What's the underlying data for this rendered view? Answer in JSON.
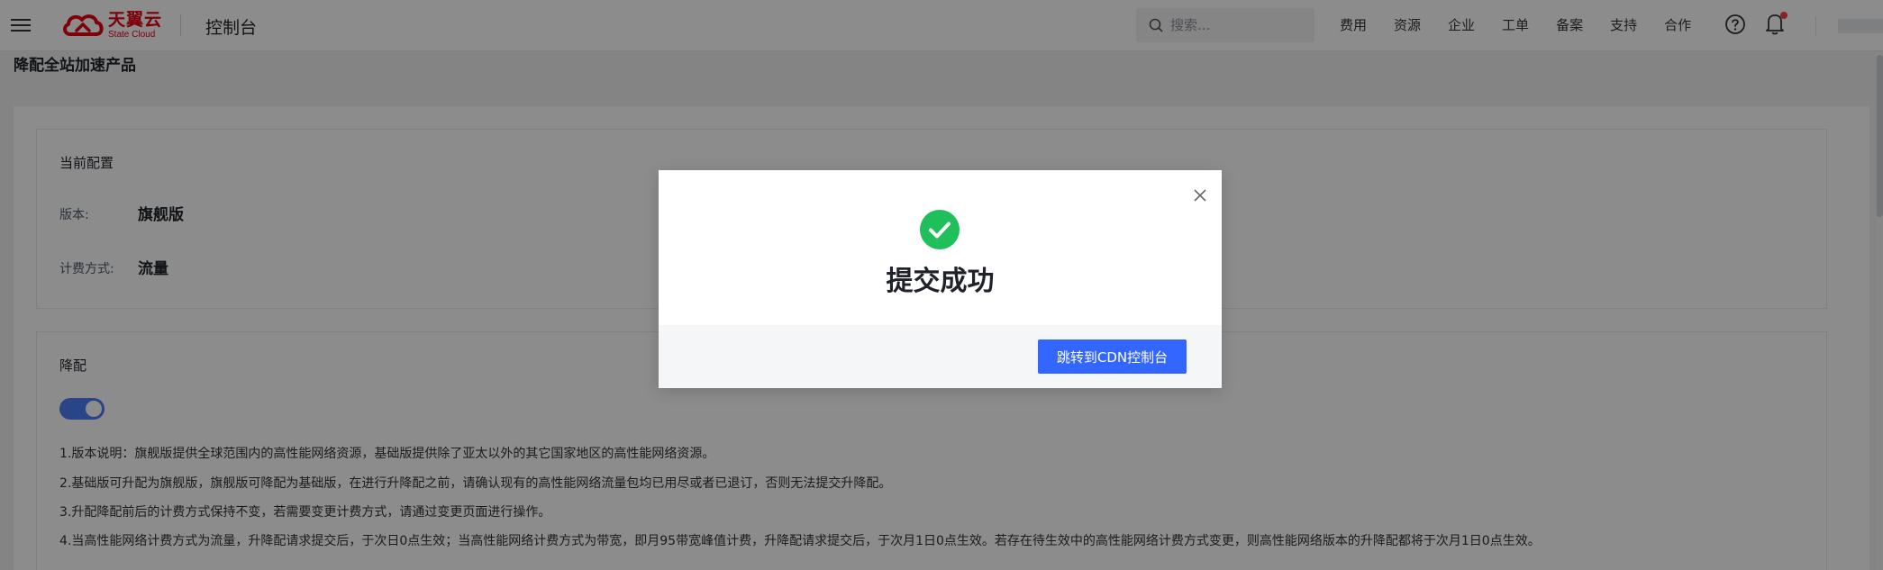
{
  "header": {
    "brand_cn": "天翼云",
    "brand_en": "State Cloud",
    "console_title": "控制台",
    "search_placeholder": "搜索...",
    "nav": [
      "费用",
      "资源",
      "企业",
      "工单",
      "备案",
      "支持",
      "合作"
    ]
  },
  "page": {
    "title": "降配全站加速产品",
    "current_config": {
      "title": "当前配置",
      "version_label": "版本:",
      "version_value": "旗舰版",
      "billing_label": "计费方式:",
      "billing_value": "流量"
    },
    "downgrade": {
      "title": "降配",
      "toggle_on": true,
      "notes": [
        "1.版本说明：旗舰版提供全球范围内的高性能网络资源，基础版提供除了亚太以外的其它国家地区的高性能网络资源。",
        "2.基础版可升配为旗舰版，旗舰版可降配为基础版，在进行升降配之前，请确认现有的高性能网络流量包均已用尽或者已退订，否则无法提交升降配。",
        "3.升配降配前后的计费方式保持不变，若需要变更计费方式，请通过变更页面进行操作。",
        "4.当高性能网络计费方式为流量，升降配请求提交后，于次日0点生效；当高性能网络计费方式为带宽，即月95带宽峰值计费，升降配请求提交后，于次月1日0点生效。若存在待生效中的高性能网络计费方式变更，则高性能网络版本的升降配都将于次月1日0点生效。"
      ]
    }
  },
  "modal": {
    "title": "提交成功",
    "primary_button": "跳转到CDN控制台"
  },
  "colors": {
    "brand_red": "#e60012",
    "primary_blue": "#3366ff",
    "success_green": "#1fbf5b"
  }
}
